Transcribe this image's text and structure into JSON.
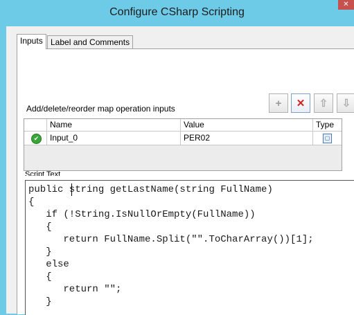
{
  "window": {
    "title": "Configure CSharp Scripting",
    "close_glyph": "✕"
  },
  "tabs": [
    {
      "label": "Inputs",
      "active": true
    },
    {
      "label": "Label and Comments",
      "active": false
    }
  ],
  "inputs_section": {
    "label": "Add/delete/reorder map operation inputs",
    "buttons": {
      "add": "+",
      "delete": "✕",
      "up": "⇧",
      "down": "⇩"
    }
  },
  "grid": {
    "columns": [
      "Name",
      "Value",
      "Type"
    ],
    "rows": [
      {
        "name": "Input_0",
        "value": "PER02",
        "status_icon": "check-icon",
        "type_icon": "type-icon"
      }
    ]
  },
  "script": {
    "label": "Script Text",
    "lines": [
      "public string getLastName(string FullName)",
      "{",
      "   if (!String.IsNullOrEmpty(FullName))",
      "   {",
      "      return FullName.Split(\"\".ToCharArray())[1];",
      "   }",
      "   else",
      "   {",
      "      return \"\";",
      "   }"
    ]
  }
}
